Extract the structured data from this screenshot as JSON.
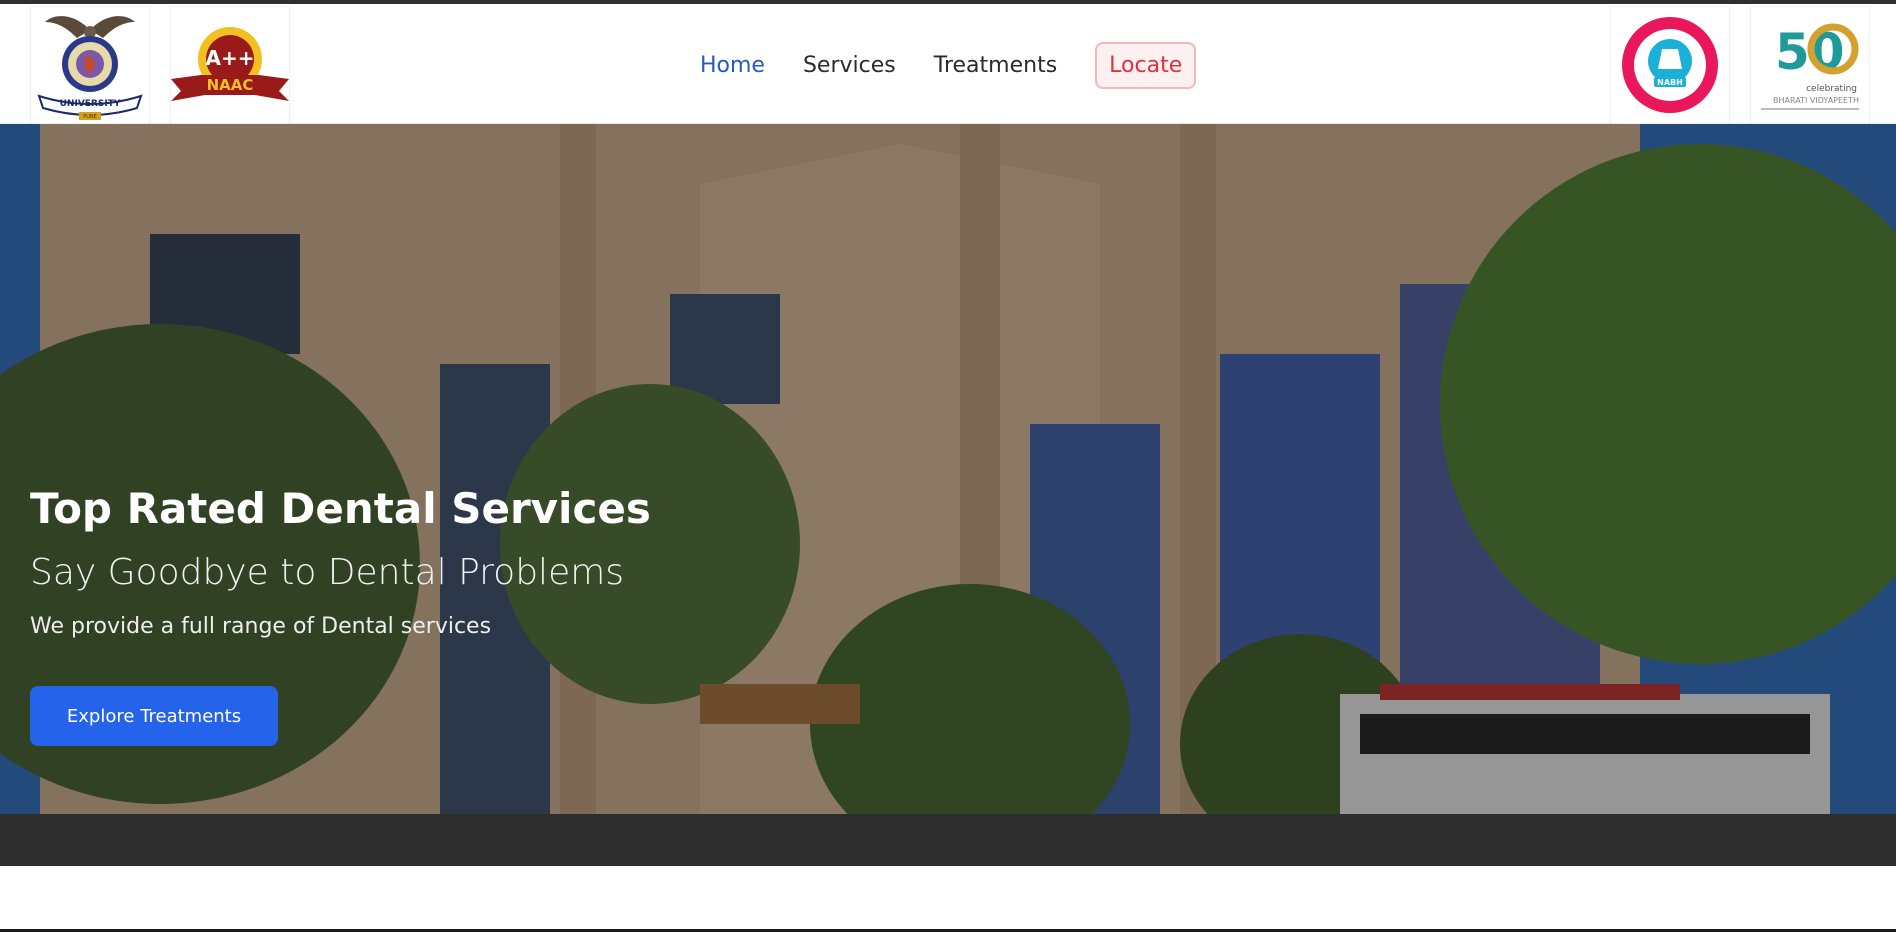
{
  "header": {
    "logos_left": [
      {
        "name": "bharati-vidyapeeth-university-logo",
        "text_top": "BHARATI VIDYAPEETH",
        "text_ribbon": "UNIVERSITY",
        "text_bottom": "PUNE"
      },
      {
        "name": "naac-a-plus-plus-badge",
        "grade": "A++",
        "label": "NAAC"
      }
    ],
    "logos_right": [
      {
        "name": "nabh-accreditation-seal",
        "label": "NABH"
      },
      {
        "name": "celebrating-50-years-logo",
        "number": "50",
        "caption1": "celebrating",
        "caption2": "BHARATI VIDYAPEETH"
      }
    ]
  },
  "nav": {
    "items": [
      {
        "label": "Home",
        "active": true
      },
      {
        "label": "Services",
        "active": false
      },
      {
        "label": "Treatments",
        "active": false
      }
    ],
    "locate_label": "Locate"
  },
  "hero": {
    "title": "Top Rated Dental Services",
    "subtitle": "Say Goodbye to Dental Problems",
    "description": "We provide a full range of Dental services",
    "button_label": "Explore Treatments",
    "background_icon": "dental-college-building-photo"
  },
  "colors": {
    "accent": "#2563eb",
    "nav_active": "#2559c9",
    "locate": "#e0303a"
  }
}
